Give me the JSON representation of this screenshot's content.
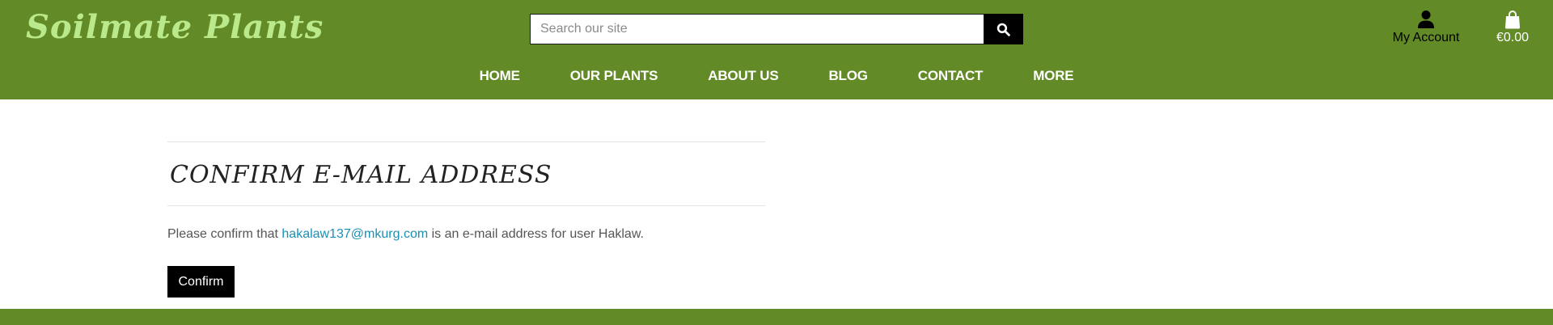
{
  "brand": {
    "name": "Soilmate Plants",
    "logo_color": "#b9e98a",
    "header_color": "#628a26"
  },
  "search": {
    "placeholder": "Search our site",
    "value": "",
    "icon": "search-icon"
  },
  "account": {
    "label": "My Account",
    "icon": "user-icon"
  },
  "cart": {
    "total": "€0.00",
    "icon": "shopping-bag-icon"
  },
  "nav": {
    "items": [
      {
        "label": "HOME"
      },
      {
        "label": "OUR PLANTS"
      },
      {
        "label": "ABOUT US"
      },
      {
        "label": "BLOG"
      },
      {
        "label": "CONTACT"
      },
      {
        "label": "MORE"
      }
    ]
  },
  "main": {
    "title": "CONFIRM E-MAIL ADDRESS",
    "message_prefix": "Please confirm that ",
    "email": "hakalaw137@mkurg.com",
    "message_suffix": " is an e-mail address for user Haklaw.",
    "confirm_label": "Confirm",
    "link_color": "#1a8fb5"
  }
}
